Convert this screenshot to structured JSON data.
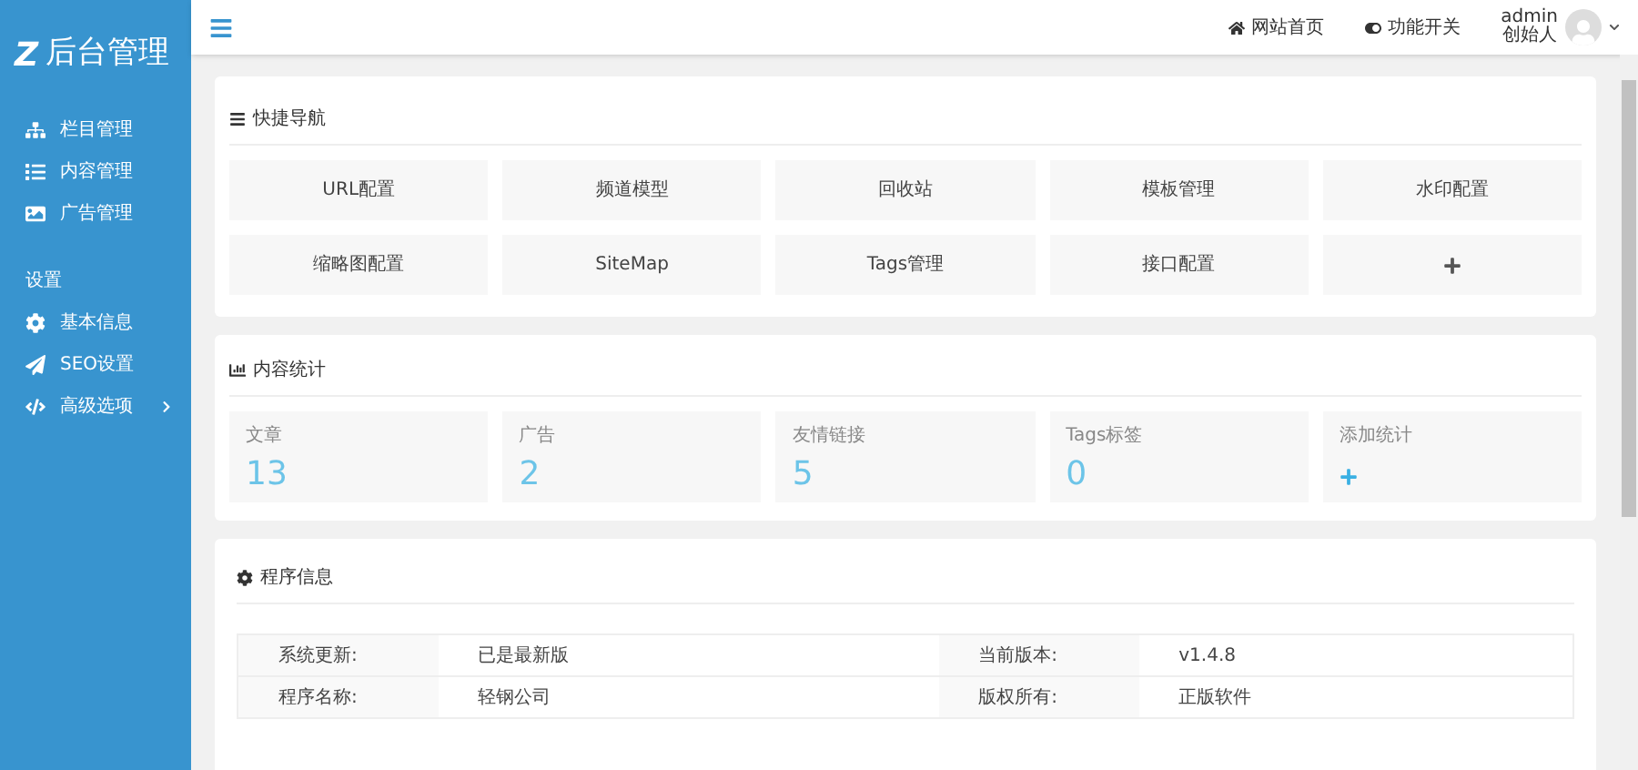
{
  "logo": {
    "mark": "Z",
    "title": "后台管理"
  },
  "sidebar": {
    "groups": [
      {
        "items": [
          {
            "kind": "sitemap",
            "label": "栏目管理"
          },
          {
            "kind": "list",
            "label": "内容管理"
          },
          {
            "kind": "image",
            "label": "广告管理"
          }
        ]
      },
      {
        "heading": "设置",
        "items": [
          {
            "kind": "gear",
            "label": "基本信息"
          },
          {
            "kind": "send",
            "label": "SEO设置"
          },
          {
            "kind": "code",
            "label": "高级选项",
            "expandable": true
          }
        ]
      }
    ]
  },
  "header": {
    "links": [
      {
        "kind": "home",
        "label": "网站首页"
      },
      {
        "kind": "toggle",
        "label": "功能开关"
      }
    ],
    "user": {
      "name": "admin",
      "role": "创始人"
    }
  },
  "quick_nav": {
    "title": "快捷导航",
    "items": [
      {
        "kind": "text",
        "label": "URL配置"
      },
      {
        "kind": "text",
        "label": "频道模型"
      },
      {
        "kind": "text",
        "label": "回收站"
      },
      {
        "kind": "text",
        "label": "模板管理"
      },
      {
        "kind": "text",
        "label": "水印配置"
      },
      {
        "kind": "text",
        "label": "缩略图配置"
      },
      {
        "kind": "text",
        "label": "SiteMap"
      },
      {
        "kind": "text",
        "label": "Tags管理"
      },
      {
        "kind": "text",
        "label": "接口配置"
      },
      {
        "kind": "add"
      }
    ]
  },
  "stats": {
    "title": "内容统计",
    "items": [
      {
        "kind": "count",
        "label": "文章",
        "value": "13"
      },
      {
        "kind": "count",
        "label": "广告",
        "value": "2"
      },
      {
        "kind": "count",
        "label": "友情链接",
        "value": "5"
      },
      {
        "kind": "count",
        "label": "Tags标签",
        "value": "0"
      },
      {
        "kind": "add",
        "label": "添加统计"
      }
    ]
  },
  "program_info": {
    "title": "程序信息",
    "rows": [
      [
        "系统更新:",
        "已是最新版",
        "当前版本:",
        "v1.4.8"
      ],
      [
        "程序名称:",
        "轻钢公司",
        "版权所有:",
        "正版软件"
      ]
    ]
  }
}
